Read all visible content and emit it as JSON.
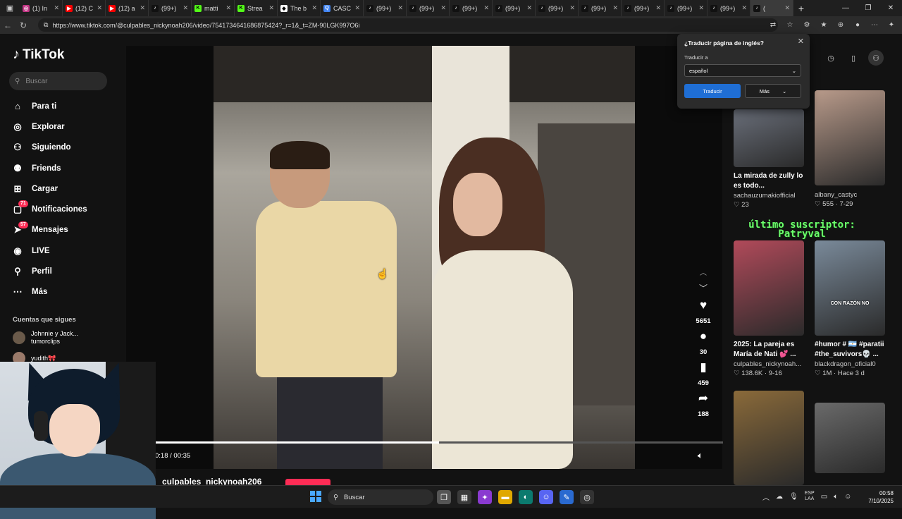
{
  "tabs": [
    {
      "title": "(1) In",
      "color": "#c13584",
      "glyph": "◎"
    },
    {
      "title": "(12) C",
      "color": "#ff0000",
      "glyph": "▶"
    },
    {
      "title": "(12) a",
      "color": "#ff0000",
      "glyph": "▶"
    },
    {
      "title": "(99+)",
      "color": "#111111",
      "glyph": "♪"
    },
    {
      "title": "matti",
      "color": "#53fc18",
      "glyph": "K"
    },
    {
      "title": "Strea",
      "color": "#53fc18",
      "glyph": "K"
    },
    {
      "title": "The b",
      "color": "#ffffff",
      "glyph": "◆"
    },
    {
      "title": "CASC",
      "color": "#4285f4",
      "glyph": "Q"
    },
    {
      "title": "(99+)",
      "color": "#111111",
      "glyph": "♪"
    },
    {
      "title": "(99+)",
      "color": "#111111",
      "glyph": "♪"
    },
    {
      "title": "(99+)",
      "color": "#111111",
      "glyph": "♪"
    },
    {
      "title": "(99+)",
      "color": "#111111",
      "glyph": "♪"
    },
    {
      "title": "(99+)",
      "color": "#111111",
      "glyph": "♪"
    },
    {
      "title": "(99+)",
      "color": "#111111",
      "glyph": "♪"
    },
    {
      "title": "(99+)",
      "color": "#111111",
      "glyph": "♪"
    },
    {
      "title": "(99+)",
      "color": "#111111",
      "glyph": "♪"
    },
    {
      "title": "(99+)",
      "color": "#111111",
      "glyph": "♪"
    }
  ],
  "active_tab": {
    "title": "(",
    "glyph": "♪"
  },
  "address": {
    "url": "https://www.tiktok.com/@culpables_nickynoah206/video/7541734641686875424?_r=1&_t=ZM-90LGK997O6i"
  },
  "sidebar": {
    "logo": "TikTok",
    "search_placeholder": "Buscar",
    "nav": [
      {
        "label": "Para ti",
        "icon": "⌂",
        "badge": ""
      },
      {
        "label": "Explorar",
        "icon": "◎",
        "badge": ""
      },
      {
        "label": "Siguiendo",
        "icon": "⚇",
        "badge": ""
      },
      {
        "label": "Friends",
        "icon": "⚉",
        "badge": ""
      },
      {
        "label": "Cargar",
        "icon": "⊞",
        "badge": ""
      },
      {
        "label": "Notificaciones",
        "icon": "▢",
        "badge": "71"
      },
      {
        "label": "Mensajes",
        "icon": "➤",
        "badge": "57"
      },
      {
        "label": "LIVE",
        "icon": "◉",
        "badge": ""
      },
      {
        "label": "Perfil",
        "icon": "⚲",
        "badge": ""
      },
      {
        "label": "Más",
        "icon": "⋯",
        "badge": ""
      }
    ],
    "following_title": "Cuentas que sigues",
    "following": [
      {
        "name": "Johnnie y Jack...",
        "handle": "tumorclips"
      },
      {
        "name": "yudith🎀",
        "handle": ""
      }
    ]
  },
  "video": {
    "time": "0:18 / 00:35",
    "progress": 0.5,
    "author": "culpables_nickynoah206",
    "likes": "5651",
    "comments": "30",
    "saves": "459",
    "shares": "188"
  },
  "translate_popup": {
    "title": "¿Traducir página de inglés?",
    "label": "Traducir a",
    "selected": "español",
    "primary": "Traducir",
    "secondary": "Más"
  },
  "overlay": {
    "line1": "último suscriptor:",
    "line2": "Patryval"
  },
  "recommendations": [
    {
      "title": "La mirada de zully lo es todo...",
      "user": "sachauzumakiofficial",
      "meta": "♡ 23",
      "bg": "#6a6f7a",
      "label": ""
    },
    {
      "title": "",
      "user": "albany_castyc",
      "meta": "♡ 555 · 7-29",
      "bg": "#b89a8a",
      "label": ""
    },
    {
      "title": "2025: La pareja es María de Nati 💕 ...",
      "user": "culpables_nickynoah...",
      "meta": "♡ 138.6K · 9-16",
      "bg": "#b14a5a",
      "label": ""
    },
    {
      "title": "#humor # 🇦🇷 #paratii #the_suvivors💀 ...",
      "user": "blackdragon_oficial0",
      "meta": "♡ 1M · Hace 3 d",
      "bg": "#7a8a9a",
      "label": "CON RAZÓN NO"
    },
    {
      "title": "",
      "user": "",
      "meta": "",
      "bg": "#8a6a3a",
      "label": ""
    },
    {
      "title": "",
      "user": "",
      "meta": "",
      "bg": "#6a6a6a",
      "label": ""
    }
  ],
  "taskbar": {
    "search": "Buscar",
    "lang_line1": "ESP",
    "lang_line2": "LAA",
    "time": "00:58",
    "date": "7/10/2025"
  }
}
